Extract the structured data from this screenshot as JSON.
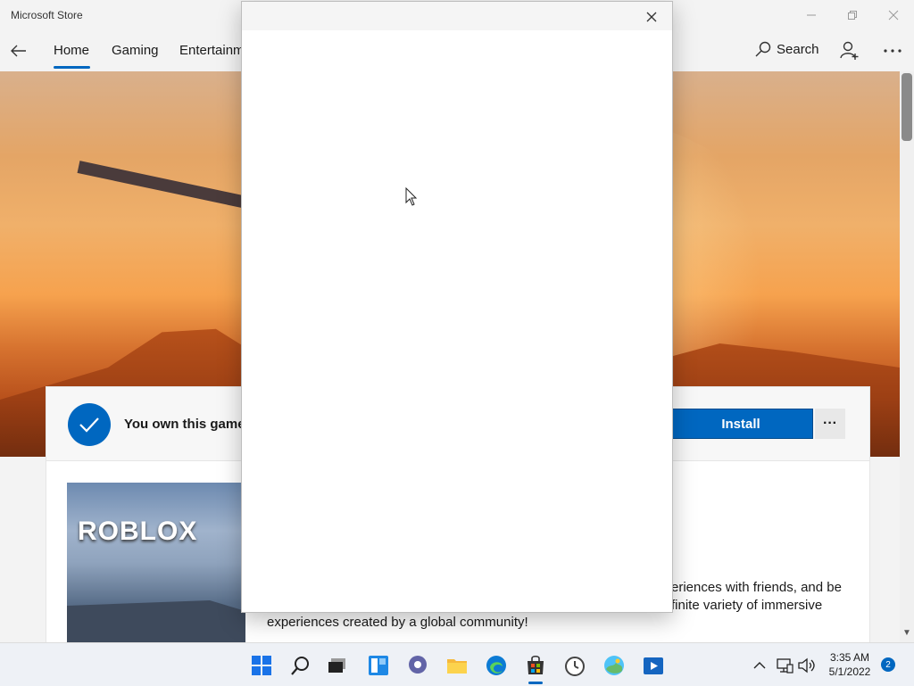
{
  "window": {
    "title": "Microsoft Store"
  },
  "nav": {
    "items": [
      {
        "label": "Home",
        "active": true
      },
      {
        "label": "Gaming",
        "active": false
      },
      {
        "label": "Entertainm",
        "active": false
      }
    ],
    "search_label": "Search"
  },
  "product": {
    "ownership_text": "You own this game.",
    "install_label": "Install",
    "more_label": "···",
    "cover_logo": "ROBLOX",
    "description_fragment_right_1": "eriences with friends, and be",
    "description_fragment_right_2": "finite variety of immersive",
    "description_line_bottom": "experiences created by a global community!"
  },
  "taskbar": {
    "time": "3:35 AM",
    "date": "5/1/2022",
    "notification_count": "2",
    "pinned_icons": [
      "start-icon",
      "search-icon",
      "task-view-icon",
      "widgets-icon",
      "chat-icon",
      "file-explorer-icon",
      "edge-icon",
      "store-icon",
      "clock-app-icon",
      "photos-icon",
      "media-player-icon"
    ]
  },
  "colors": {
    "accent": "#0067c0",
    "background": "#f3f3f3",
    "taskbar": "#eef1f6"
  }
}
